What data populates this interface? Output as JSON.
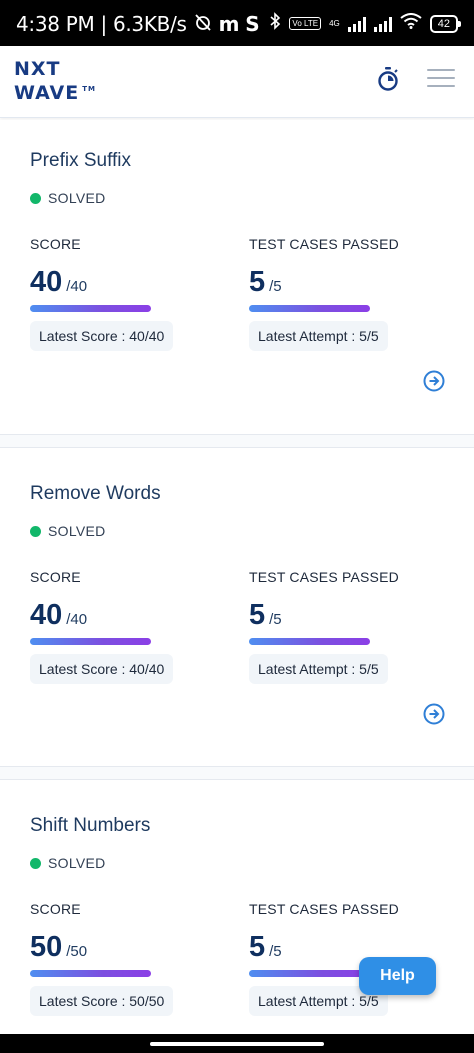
{
  "status_bar": {
    "time": "4:38 PM",
    "net_speed": "6.3KB/s",
    "app_icons": [
      "m",
      "S"
    ],
    "volte": "Vo LTE",
    "network": "4G",
    "battery": "42"
  },
  "header": {
    "logo_line1": "NXT",
    "logo_line2": "WAVE",
    "logo_tm": "TM"
  },
  "score_label": "SCORE",
  "tests_label": "TEST CASES PASSED",
  "problems": [
    {
      "title": "Prefix Suffix",
      "status": "SOLVED",
      "score": "40",
      "score_total": "/40",
      "tests": "5",
      "tests_total": "/5",
      "latest_score": "Latest Score : 40/40",
      "latest_attempt": "Latest Attempt : 5/5"
    },
    {
      "title": "Remove Words",
      "status": "SOLVED",
      "score": "40",
      "score_total": "/40",
      "tests": "5",
      "tests_total": "/5",
      "latest_score": "Latest Score : 40/40",
      "latest_attempt": "Latest Attempt : 5/5"
    },
    {
      "title": "Shift Numbers",
      "status": "SOLVED",
      "score": "50",
      "score_total": "/50",
      "tests": "5",
      "tests_total": "/5",
      "latest_score": "Latest Score : 50/50",
      "latest_attempt": "Latest Attempt : 5/5"
    }
  ],
  "help_label": "Help",
  "colors": {
    "brand": "#183b83",
    "solved": "#12b76a",
    "accent": "#2f8fe6"
  }
}
